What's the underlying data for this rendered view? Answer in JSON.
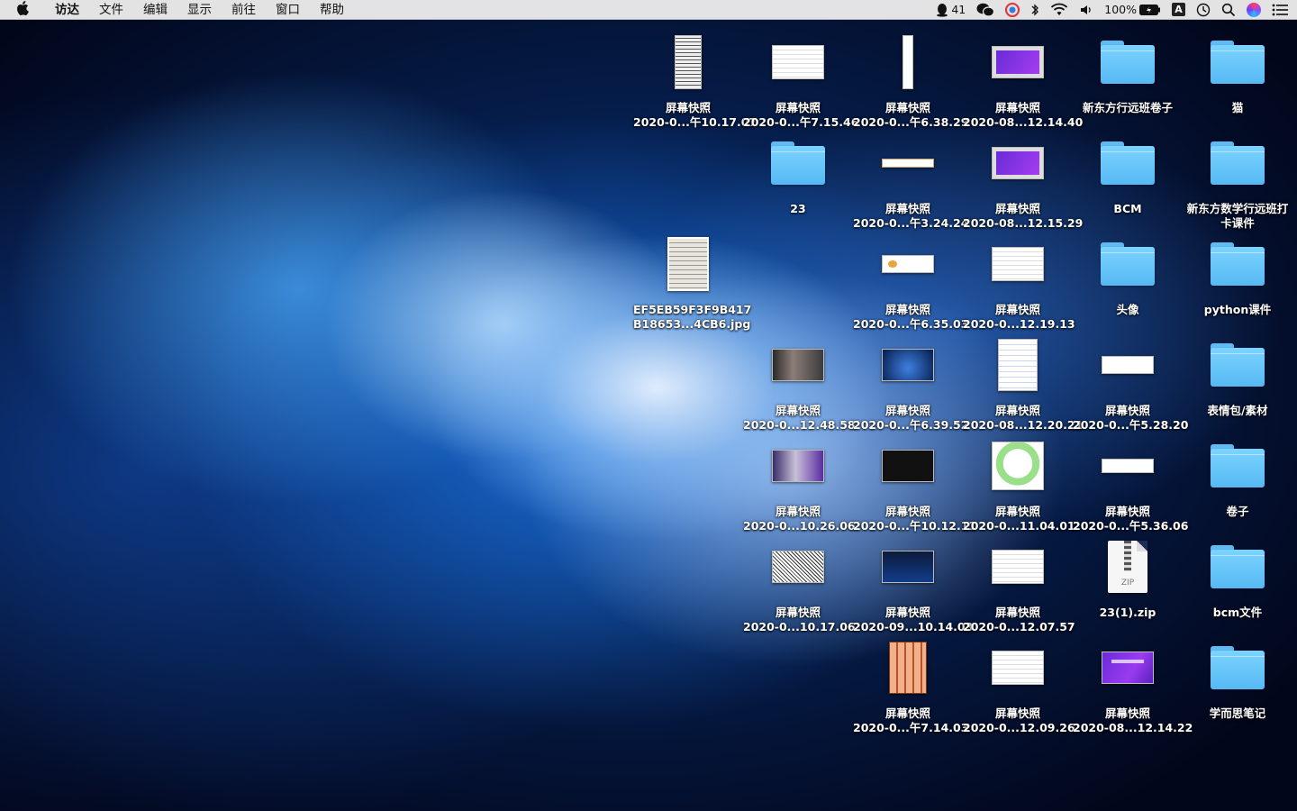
{
  "menubar": {
    "app_name": "访达",
    "menus": [
      "文件",
      "编辑",
      "显示",
      "前往",
      "窗口",
      "帮助"
    ],
    "qq_count": "41",
    "battery": "100%",
    "input_method": "A"
  },
  "desktop": {
    "items": [
      {
        "id": "r1c1",
        "line1": "屏幕快照",
        "line2": "2020-0...午10.17.07",
        "kind": "manga-tall"
      },
      {
        "id": "r1c2",
        "line1": "屏幕快照",
        "line2": "2020-0...午7.15.46",
        "kind": "doc"
      },
      {
        "id": "r1c3",
        "line1": "屏幕快照",
        "line2": "2020-0...午6.38.29",
        "kind": "tall-strip"
      },
      {
        "id": "r1c4",
        "line1": "屏幕快照",
        "line2": "2020-08...12.14.40",
        "kind": "purple-frame"
      },
      {
        "id": "r1c5",
        "line1": "新东方行远班卷子",
        "line2": "",
        "kind": "folder"
      },
      {
        "id": "r1c6",
        "line1": "猫",
        "line2": "",
        "kind": "folder"
      },
      {
        "id": "r2c2",
        "line1": "23",
        "line2": "",
        "kind": "folder"
      },
      {
        "id": "r2c3",
        "line1": "屏幕快照",
        "line2": "2020-0...午3.24.24",
        "kind": "thin-strip"
      },
      {
        "id": "r2c4",
        "line1": "屏幕快照",
        "line2": "2020-08...12.15.29",
        "kind": "purple-frame"
      },
      {
        "id": "r2c5",
        "line1": "BCM",
        "line2": "",
        "kind": "folder"
      },
      {
        "id": "r2c6",
        "line1": "新东方数学行远班打",
        "line2": "卡课件",
        "kind": "folder"
      },
      {
        "id": "r3c1",
        "line1": "EF5EB59F3F9B417",
        "line2": "B18653...4CB6.jpg",
        "kind": "hand"
      },
      {
        "id": "r3c3",
        "line1": "屏幕快照",
        "line2": "2020-0...午6.35.03",
        "kind": "yellow-pill"
      },
      {
        "id": "r3c4",
        "line1": "屏幕快照",
        "line2": "2020-0...12.19.13",
        "kind": "doc"
      },
      {
        "id": "r3c5",
        "line1": "头像",
        "line2": "",
        "kind": "folder"
      },
      {
        "id": "r3c6",
        "line1": "python课件",
        "line2": "",
        "kind": "folder"
      },
      {
        "id": "r4c2",
        "line1": "屏幕快照",
        "line2": "2020-0...12.48.58",
        "kind": "photo"
      },
      {
        "id": "r4c3",
        "line1": "屏幕快照",
        "line2": "2020-0...午6.39.52",
        "kind": "darkblue"
      },
      {
        "id": "r4c4",
        "line1": "屏幕快照",
        "line2": "2020-08...12.20.21",
        "kind": "doc-tall"
      },
      {
        "id": "r4c5",
        "line1": "屏幕快照",
        "line2": "2020-0...午5.28.20",
        "kind": "wide-white"
      },
      {
        "id": "r4c6",
        "line1": "表情包/素材",
        "line2": "",
        "kind": "folder"
      },
      {
        "id": "r5c2",
        "line1": "屏幕快照",
        "line2": "2020-0...10.26.06",
        "kind": "anime"
      },
      {
        "id": "r5c3",
        "line1": "屏幕快照",
        "line2": "2020-0...午10.12.11",
        "kind": "black"
      },
      {
        "id": "r5c4",
        "line1": "屏幕快照",
        "line2": "2020-0...11.04.01",
        "kind": "cat"
      },
      {
        "id": "r5c5",
        "line1": "屏幕快照",
        "line2": "2020-0...午5.36.06",
        "kind": "wide-white2"
      },
      {
        "id": "r5c6",
        "line1": "卷子",
        "line2": "",
        "kind": "folder"
      },
      {
        "id": "r6c2",
        "line1": "屏幕快照",
        "line2": "2020-0...10.17.06",
        "kind": "manga"
      },
      {
        "id": "r6c3",
        "line1": "屏幕快照",
        "line2": "2020-09...10.14.03",
        "kind": "dark"
      },
      {
        "id": "r6c4",
        "line1": "屏幕快照",
        "line2": "2020-0...12.07.57",
        "kind": "doc"
      },
      {
        "id": "r6c5",
        "line1": "23(1).zip",
        "line2": "",
        "kind": "zip",
        "zip_label": "ZIP"
      },
      {
        "id": "r6c6",
        "line1": "bcm文件",
        "line2": "",
        "kind": "folder"
      },
      {
        "id": "r7c3",
        "line1": "屏幕快照",
        "line2": "2020-0...午7.14.03",
        "kind": "calc"
      },
      {
        "id": "r7c4",
        "line1": "屏幕快照",
        "line2": "2020-0...12.09.26",
        "kind": "doc"
      },
      {
        "id": "r7c5",
        "line1": "屏幕快照",
        "line2": "2020-08...12.14.22",
        "kind": "purple"
      },
      {
        "id": "r7c6",
        "line1": "学而思笔记",
        "line2": "",
        "kind": "folder"
      }
    ]
  }
}
